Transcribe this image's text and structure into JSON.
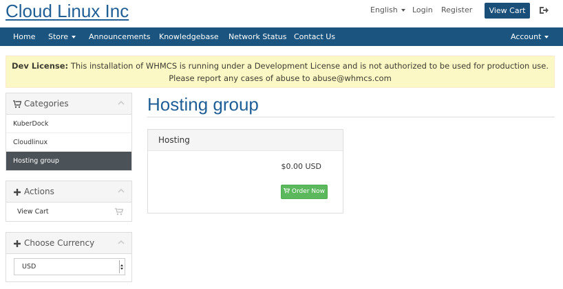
{
  "header": {
    "logo": "Cloud Linux Inc",
    "language": "English",
    "login": "Login",
    "register": "Register",
    "view_cart": "View Cart",
    "logout_icon": "sign-out-icon"
  },
  "nav": {
    "home": "Home",
    "store": "Store",
    "announcements": "Announcements",
    "knowledgebase": "Knowledgebase",
    "network_status": "Network Status",
    "contact_us": "Contact Us",
    "account": "Account"
  },
  "alert": {
    "label": "Dev License:",
    "message": "This installation of WHMCS is running under a Development License and is not authorized to be used for production use. Please report any cases of abuse to abuse@whmcs.com"
  },
  "sidebar": {
    "categories": {
      "title": "Categories",
      "icon": "shopping-cart-icon",
      "items": [
        "KuberDock",
        "Cloudlinux",
        "Hosting group"
      ],
      "active": "Hosting group"
    },
    "actions": {
      "title": "Actions",
      "icon": "plus-icon",
      "items": [
        "View Cart"
      ]
    },
    "currency": {
      "title": "Choose Currency",
      "icon": "plus-icon",
      "selected": "USD"
    }
  },
  "main": {
    "title": "Hosting group",
    "product": {
      "name": "Hosting",
      "price": "$0.00 USD",
      "order_button": "Order Now"
    }
  },
  "colors": {
    "brand_blue": "#1f5f96",
    "navbar": "#1b557f",
    "alert_bg": "#fcf8c5",
    "order_green": "#5cb85c",
    "active_item": "#4b5258"
  }
}
